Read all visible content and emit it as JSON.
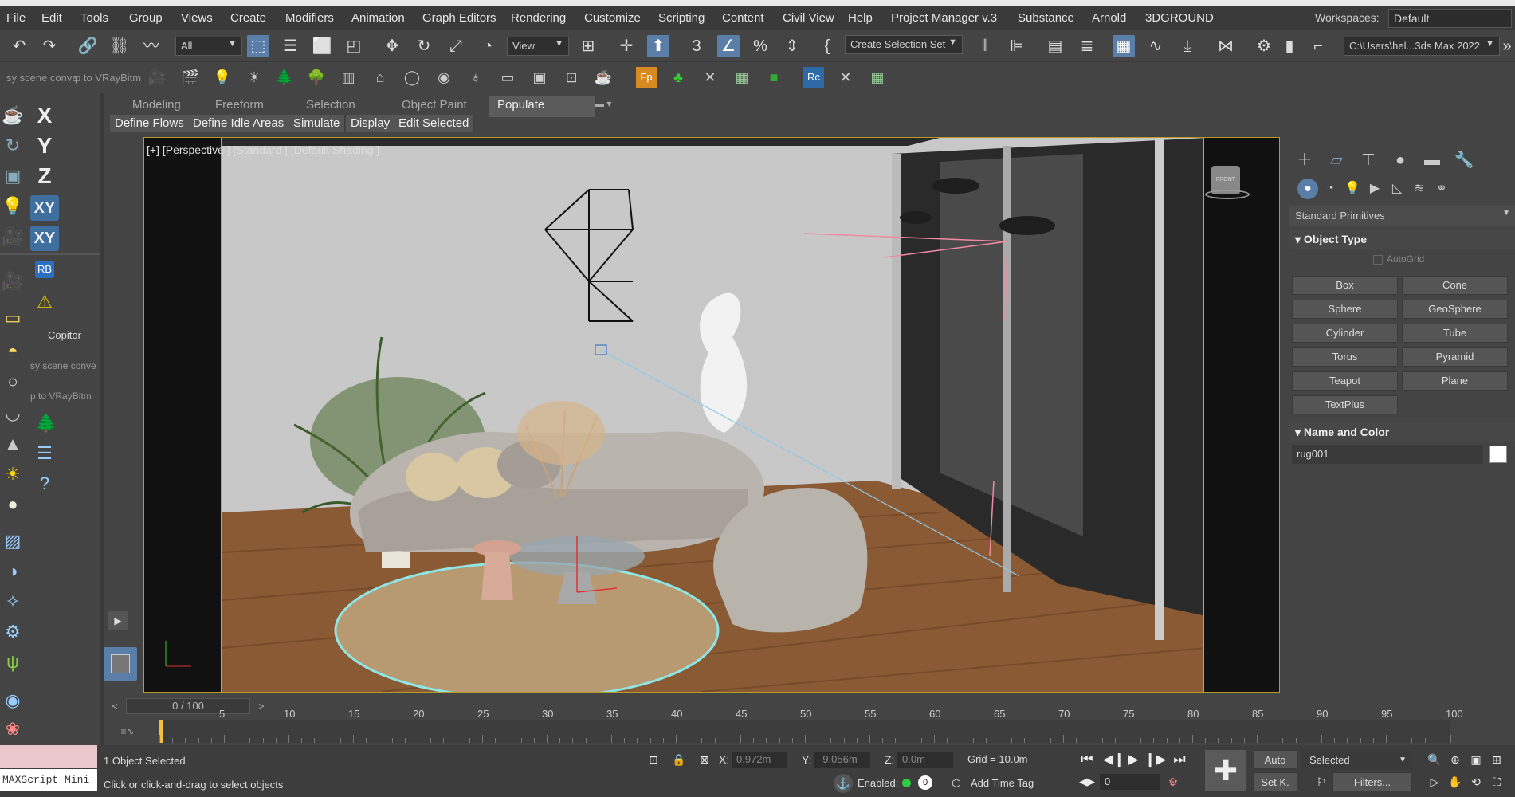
{
  "menubar": {
    "items": [
      "File",
      "Edit",
      "Tools",
      "Group",
      "Views",
      "Create",
      "Modifiers",
      "Animation",
      "Graph Editors",
      "Rendering",
      "Customize",
      "Scripting",
      "Content",
      "Civil View",
      "Help",
      "Project Manager v.3",
      "Substance",
      "Arnold",
      "3DGROUND"
    ],
    "workspaces_label": "Workspaces:",
    "workspace_value": "Default"
  },
  "toolbar": {
    "filter_value": "All",
    "refcoord_value": "View",
    "selection_set_placeholder": "Create Selection Set",
    "path_value": "C:\\Users\\hel...3ds Max 2022"
  },
  "toolbar2": {
    "script_text_1": "sy scene conve",
    "script_text_2": "p to VRayBitm"
  },
  "ribbon": {
    "tabs": [
      "Modeling",
      "Freeform",
      "Selection",
      "Object Paint",
      "Populate"
    ],
    "active_tab": "Populate",
    "buttons": [
      "Define Flows",
      "Define Idle Areas",
      "Simulate",
      "Display",
      "Edit Selected"
    ]
  },
  "leftbar": {
    "axes": [
      "X",
      "Y",
      "Z",
      "XY",
      "XY"
    ],
    "rb_label": "RB",
    "copitor_label": "Copitor",
    "script_text_1": "sy scene conve",
    "script_text_2": "p to VRayBitm"
  },
  "viewport": {
    "label": "[+] [Perspective ] [Standard ] [Default Shading ]",
    "viewcube_label": "FRONT"
  },
  "command_panel": {
    "category": "Standard Primitives",
    "object_type_title": "Object Type",
    "autogrid_label": "AutoGrid",
    "buttons": [
      "Box",
      "Cone",
      "Sphere",
      "GeoSphere",
      "Cylinder",
      "Tube",
      "Torus",
      "Pyramid",
      "Teapot",
      "Plane",
      "TextPlus"
    ],
    "name_color_title": "Name and Color",
    "object_name": "rug001",
    "object_color": "#ffffff"
  },
  "timeline": {
    "slider_label": "0 / 100",
    "ticks": [
      "5",
      "10",
      "15",
      "20",
      "25",
      "30",
      "35",
      "40",
      "45",
      "50",
      "55",
      "60",
      "65",
      "70",
      "75",
      "80",
      "85",
      "90",
      "95",
      "100"
    ]
  },
  "status": {
    "maxscript_label": "MAXScript Mini",
    "selection_info": "1 Object Selected",
    "prompt": "Click or click-and-drag to select objects",
    "x_label": "X:",
    "x_value": "0.972m",
    "y_label": "Y:",
    "y_value": "-9.056m",
    "z_label": "Z:",
    "z_value": "0.0m",
    "grid": "Grid = 10.0m",
    "enabled_label": "Enabled:",
    "add_time_tag": "Add Time Tag",
    "auto_label": "Auto",
    "setkey_label": "Set K.",
    "selected_value": "Selected",
    "filters_label": "Filters...",
    "frame_value": "0",
    "enabled_count": "0"
  }
}
